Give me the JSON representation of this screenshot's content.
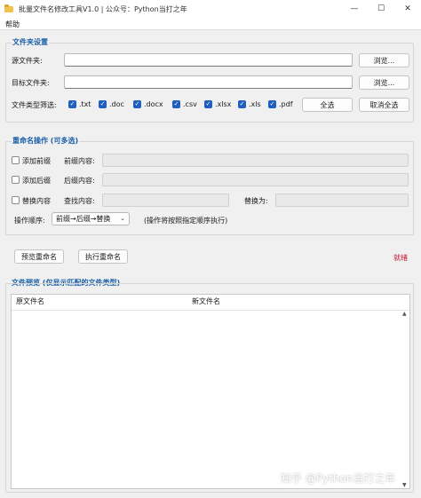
{
  "window": {
    "title": "批量文件名修改工具V1.0 | 公众号：Python当打之年",
    "icon": "folder-icon",
    "controls": {
      "minimize": "—",
      "maximize": "☐",
      "close": "✕"
    }
  },
  "menu": {
    "help": "帮助"
  },
  "folder_settings": {
    "title": "文件夹设置",
    "source_label": "源文件夹:",
    "source_value": "",
    "target_label": "目标文件夹:",
    "target_value": "",
    "browse_label": "浏览...",
    "filter_label": "文件类型筛选:",
    "types": [
      ".txt",
      ".doc",
      ".docx",
      ".csv",
      ".xlsx",
      ".xls",
      ".pdf"
    ],
    "select_all": "全选",
    "deselect_all": "取消全选"
  },
  "rename_ops": {
    "title": "重命名操作 (可多选)",
    "add_prefix": "添加前缀",
    "prefix_label": "前缀内容:",
    "add_suffix": "添加后缀",
    "suffix_label": "后缀内容:",
    "replace": "替换内容",
    "find_label": "查找内容:",
    "replace_with_label": "替换为:",
    "order_label": "操作顺序:",
    "order_value": "前缀→后缀→替换",
    "order_hint": "(操作将按照指定顺序执行)"
  },
  "actions": {
    "preview": "预览重命名",
    "execute": "执行重命名",
    "status": "就绪"
  },
  "preview": {
    "title": "文件预览 (仅显示匹配的文件类型)",
    "col_original": "原文件名",
    "col_new": "新文件名"
  },
  "watermark": "知乎 @Python当打之年",
  "colors": {
    "accent": "#1a5fa8",
    "checkbox": "#1f5fbf",
    "status": "#c8102e"
  }
}
